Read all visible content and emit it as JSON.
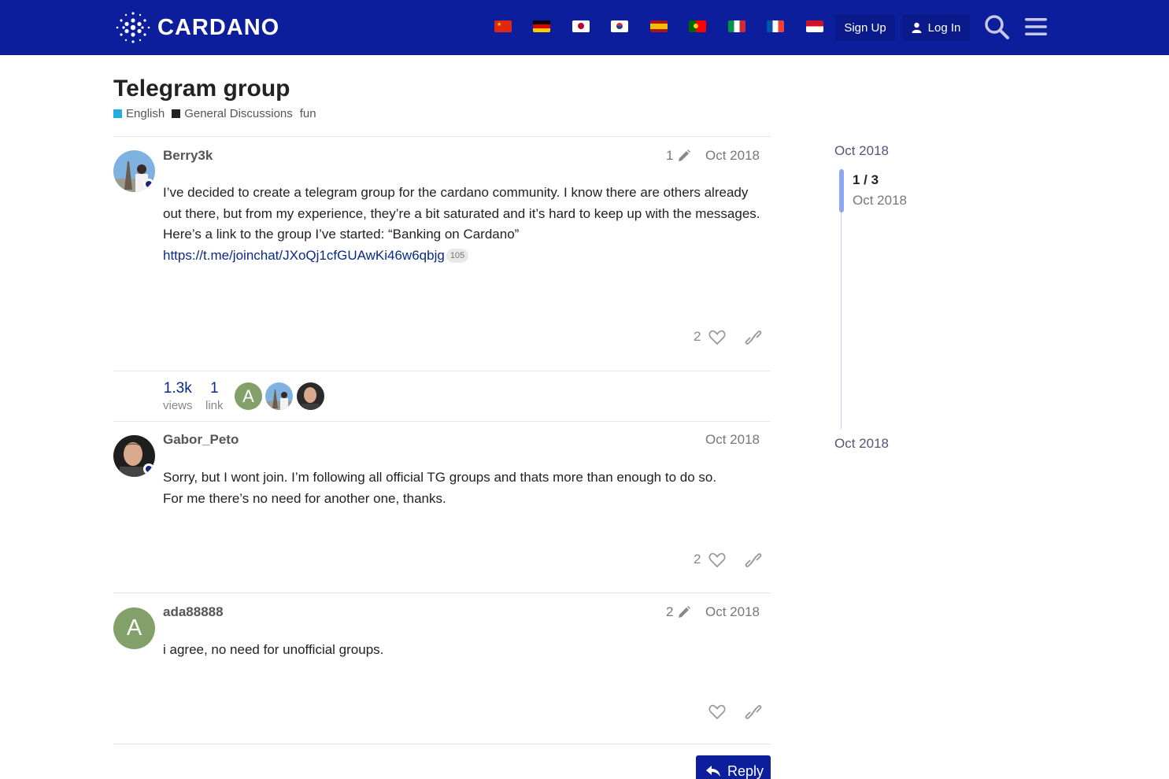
{
  "header": {
    "brand": "CARDANO",
    "languages": [
      {
        "name": "flag-china-icon",
        "colors": [
          "#de2910",
          "#ffde00"
        ]
      },
      {
        "name": "flag-germany-icon",
        "colors": [
          "#000000",
          "#dd0000",
          "#ffce00"
        ]
      },
      {
        "name": "flag-japan-icon",
        "colors": [
          "#ffffff",
          "#bc002d"
        ]
      },
      {
        "name": "flag-korea-icon",
        "colors": [
          "#ffffff",
          "#cd2e3a",
          "#0047a0"
        ]
      },
      {
        "name": "flag-spain-icon",
        "colors": [
          "#aa151b",
          "#f1bf00"
        ]
      },
      {
        "name": "flag-portugal-icon",
        "colors": [
          "#006600",
          "#ff0000"
        ]
      },
      {
        "name": "flag-italy-icon",
        "colors": [
          "#009246",
          "#ffffff",
          "#ce2b37"
        ]
      },
      {
        "name": "flag-france-icon",
        "colors": [
          "#0055a4",
          "#ffffff",
          "#ef4135"
        ]
      },
      {
        "name": "flag-indonesia-icon",
        "colors": [
          "#ce1126",
          "#ffffff"
        ]
      }
    ],
    "signup_label": "Sign Up",
    "login_label": "Log In"
  },
  "topic": {
    "title": "Telegram group",
    "categories": [
      {
        "label": "English",
        "color": "#25aae1"
      },
      {
        "label": "General Discussions",
        "color": "#231f20"
      }
    ],
    "tag": "fun"
  },
  "posts": [
    {
      "username": "Berry3k",
      "edits": "1",
      "date": "Oct 2018",
      "lines": [
        "I’ve decided to create a telegram group for the cardano community. I know there are others already out there, but from my experience, they’re a bit saturated and it’s hard to keep up with the messages.",
        "Here’s a link to the group I’ve started: “Banking on Cardano”"
      ],
      "link_text": "https://t.me/joinchat/JXoQj1cfGUAwKi46w6qbjg",
      "link_clicks": "105",
      "likes": "2"
    },
    {
      "username": "Gabor_Peto",
      "date": "Oct 2018",
      "lines": [
        "Sorry, but I wont join. I’m following all official TG groups and thats more than enough to do so.",
        "For me there’s no need for another one, thanks."
      ],
      "likes": "2"
    },
    {
      "username": "ada88888",
      "edits": "2",
      "date": "Oct 2018",
      "avatar_letter": "A",
      "lines": [
        "i agree, no need for unofficial groups."
      ]
    }
  ],
  "topic_map": {
    "views": "1.3k",
    "views_label": "views",
    "links": "1",
    "links_label": "link",
    "participant_letter": "A"
  },
  "timeline": {
    "start_date": "Oct 2018",
    "position": "1 / 3",
    "position_date": "Oct 2018",
    "end_date": "Oct 2018"
  },
  "reply_label": "Reply",
  "colors": {
    "header_bg": "#0d1e9c",
    "link": "#0a2a86",
    "avatar_green": "#83a06a"
  }
}
